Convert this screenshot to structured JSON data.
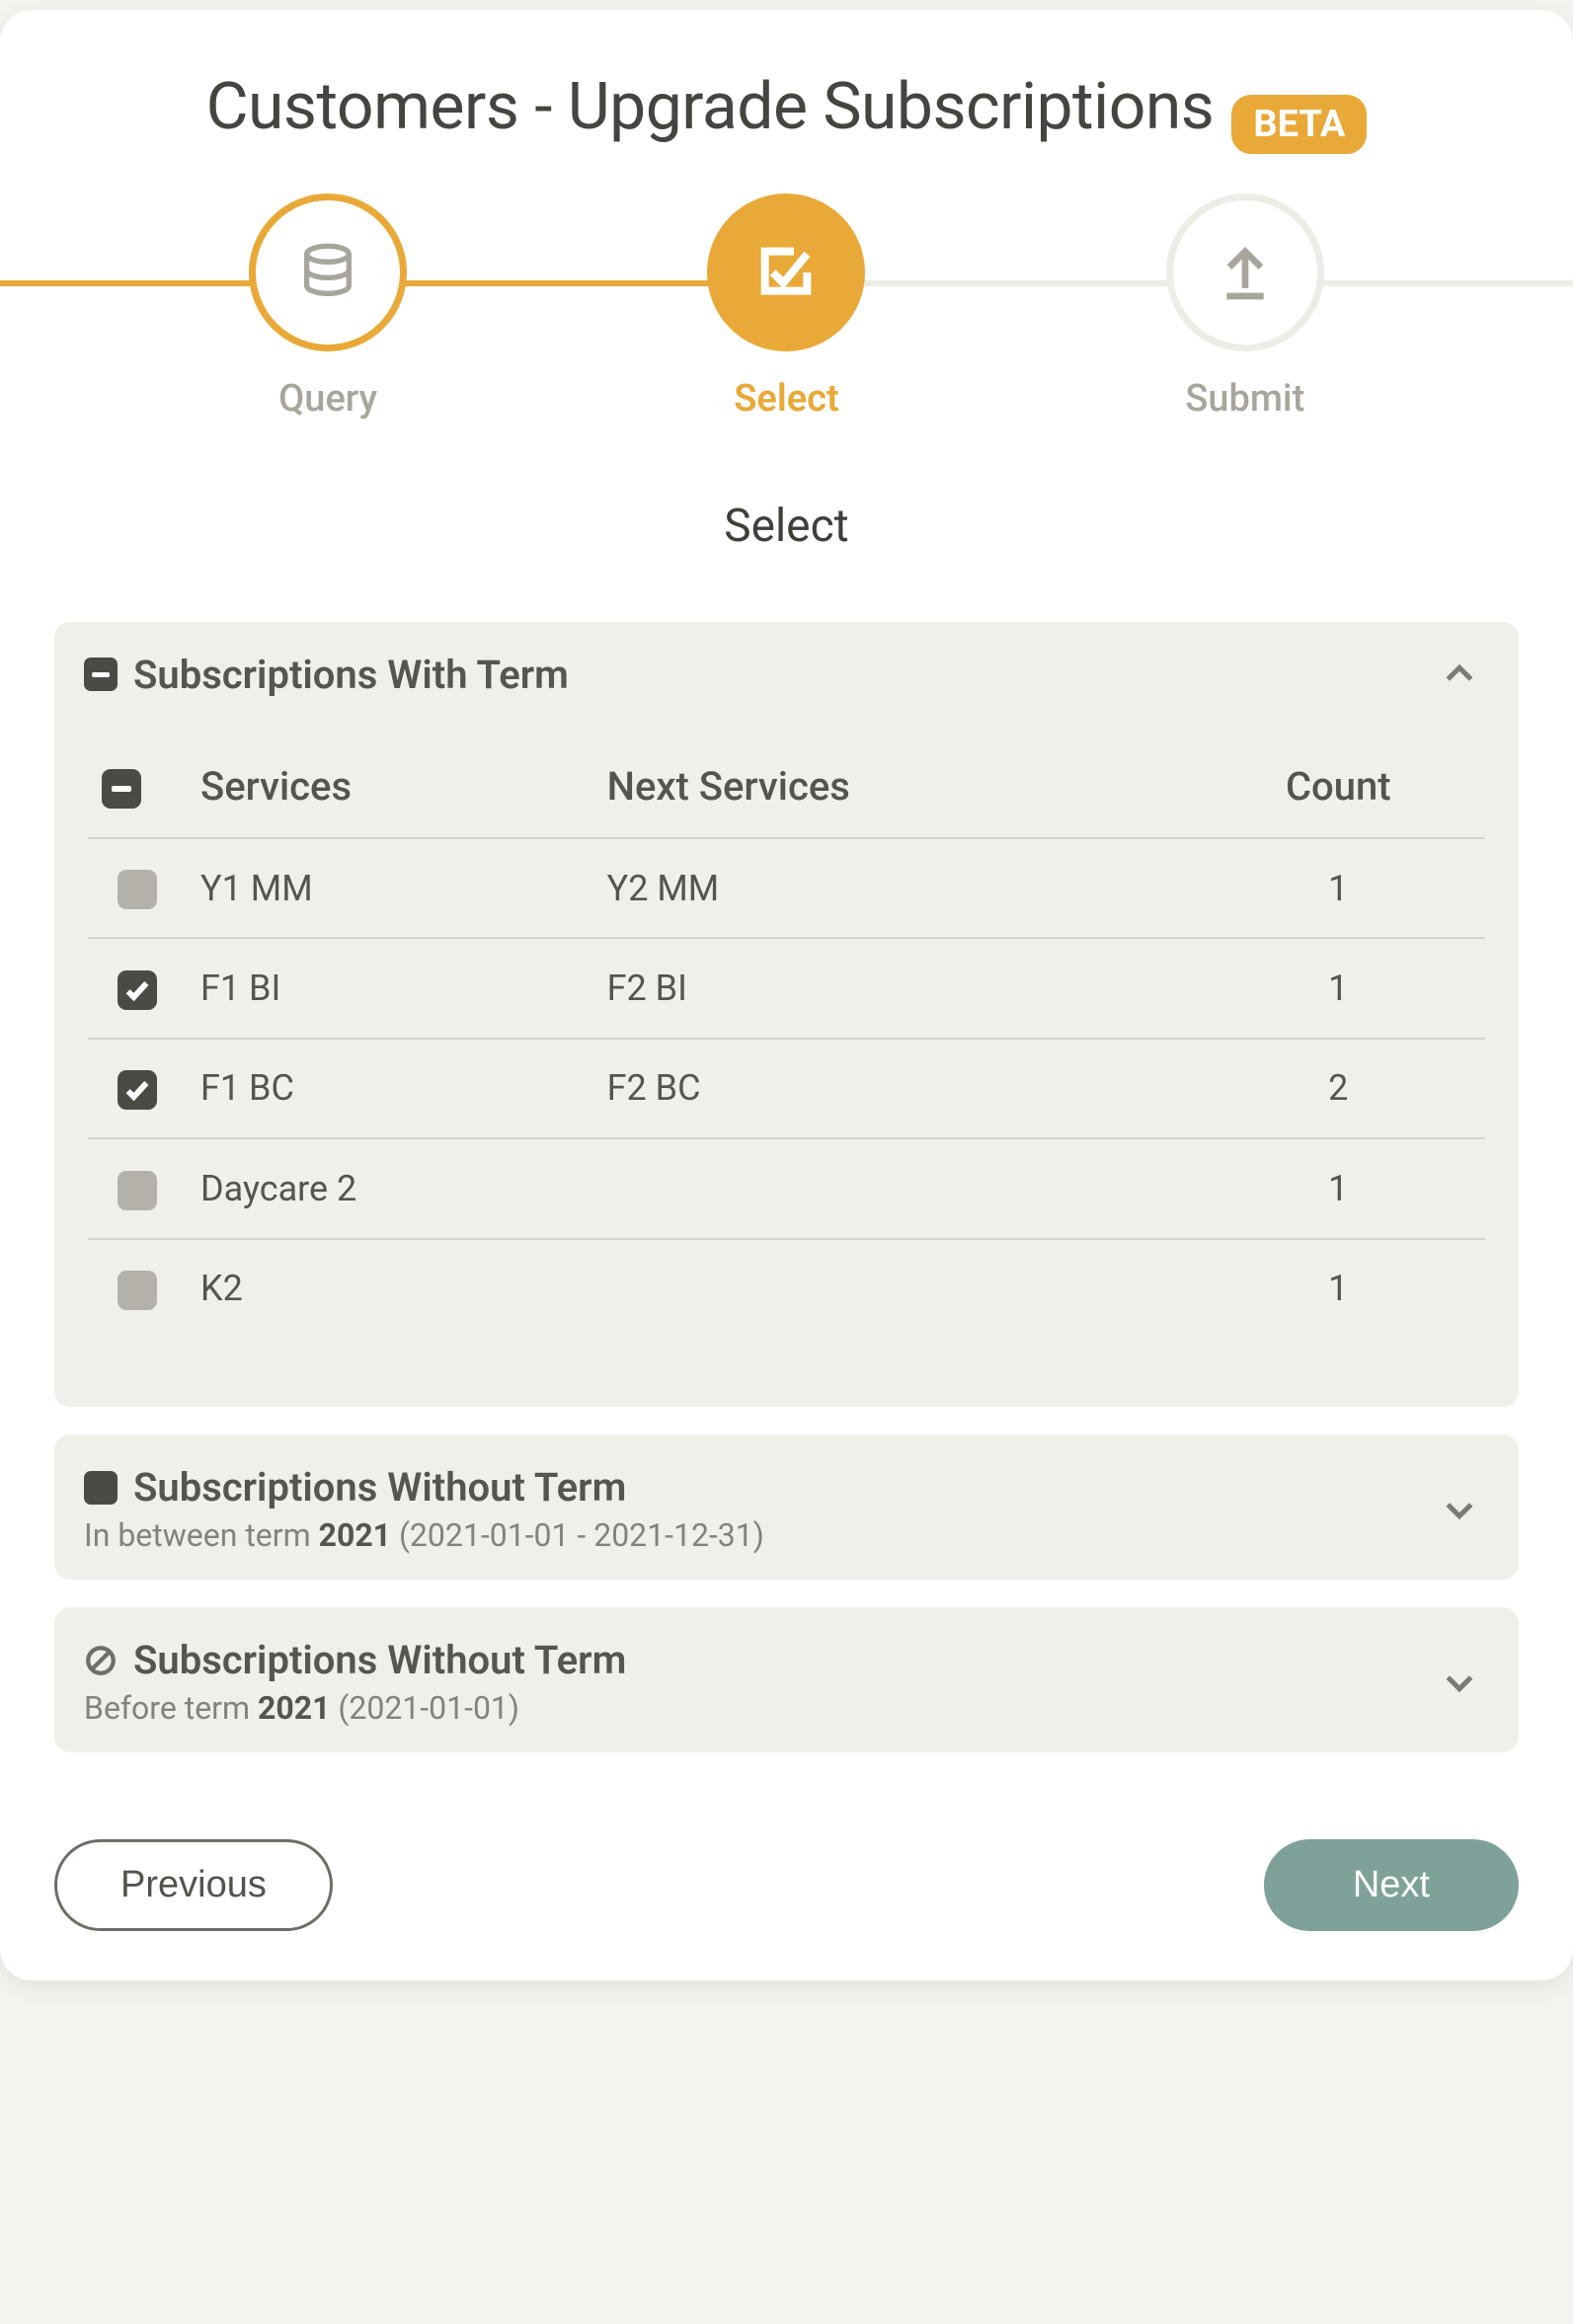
{
  "header": {
    "title": "Customers - Upgrade Subscriptions",
    "badge": "BETA"
  },
  "stepper": {
    "steps": [
      {
        "label": "Query",
        "state": "done",
        "icon": "database-icon"
      },
      {
        "label": "Select",
        "state": "active",
        "icon": "check-square-icon"
      },
      {
        "label": "Submit",
        "state": "future",
        "icon": "upload-icon"
      }
    ]
  },
  "section_title": "Select",
  "panels": {
    "with_term": {
      "title": "Subscriptions With Term",
      "expanded": true,
      "header_check_state": "indeterminate",
      "columns": {
        "services": "Services",
        "next_services": "Next Services",
        "count": "Count"
      },
      "table_check_state": "indeterminate",
      "rows": [
        {
          "checked": false,
          "services": "Y1 MM",
          "next_services": "Y2 MM",
          "count": 1
        },
        {
          "checked": true,
          "services": "F1 BI",
          "next_services": "F2 BI",
          "count": 1
        },
        {
          "checked": true,
          "services": "F1 BC",
          "next_services": "F2 BC",
          "count": 2
        },
        {
          "checked": false,
          "services": "Daycare 2",
          "next_services": "",
          "count": 1
        },
        {
          "checked": false,
          "services": "K2",
          "next_services": "",
          "count": 1
        }
      ]
    },
    "without_term_in_between": {
      "title": "Subscriptions Without Term",
      "sub_prefix": "In between term ",
      "sub_term": "2021",
      "sub_suffix": " (2021-01-01 - 2021-12-31)",
      "expanded": false,
      "header_icon": "solid"
    },
    "without_term_before": {
      "title": "Subscriptions Without Term",
      "sub_prefix": "Before term ",
      "sub_term": "2021",
      "sub_suffix": " (2021-01-01)",
      "expanded": false,
      "header_icon": "cancel"
    }
  },
  "footer": {
    "prev": "Previous",
    "next": "Next"
  }
}
